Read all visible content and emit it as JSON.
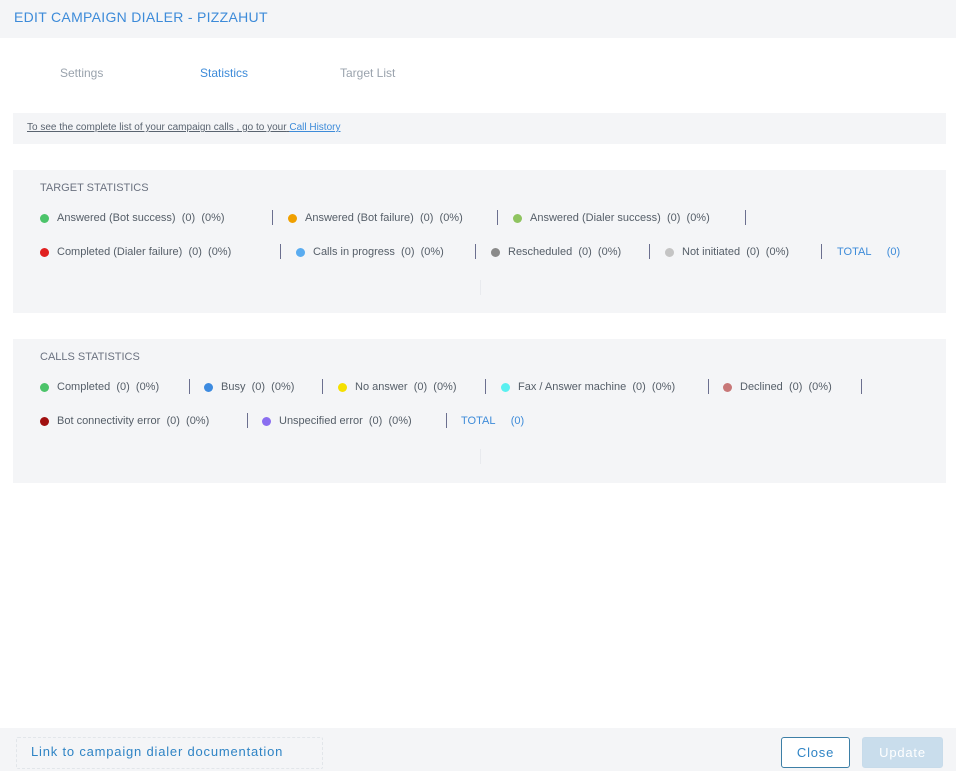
{
  "header": {
    "title": "EDIT CAMPAIGN DIALER - PIZZAHUT"
  },
  "tabs": [
    {
      "label": "Settings",
      "active": false
    },
    {
      "label": "Statistics",
      "active": true
    },
    {
      "label": "Target List",
      "active": false
    }
  ],
  "info": {
    "text": "To see the complete list of your campaign calls , go to your",
    "link": "Call History"
  },
  "target_statistics": {
    "title": "TARGET STATISTICS",
    "items": [
      {
        "label": "Answered (Bot success)",
        "count": "(0)",
        "percent": "(0%)",
        "color": "#4cc46a"
      },
      {
        "label": "Answered (Bot failure)",
        "count": "(0)",
        "percent": "(0%)",
        "color": "#f0a000"
      },
      {
        "label": "Answered (Dialer success)",
        "count": "(0)",
        "percent": "(0%)",
        "color": "#8fc460"
      },
      {
        "label": "Completed (Dialer failure)",
        "count": "(0)",
        "percent": "(0%)",
        "color": "#e02020"
      },
      {
        "label": "Calls in progress",
        "count": "(0)",
        "percent": "(0%)",
        "color": "#5aacf0"
      },
      {
        "label": "Rescheduled",
        "count": "(0)",
        "percent": "(0%)",
        "color": "#8a8a8a"
      },
      {
        "label": "Not initiated",
        "count": "(0)",
        "percent": "(0%)",
        "color": "#c4c4c4"
      }
    ],
    "total_label": "TOTAL",
    "total_value": "(0)"
  },
  "calls_statistics": {
    "title": "CALLS STATISTICS",
    "items": [
      {
        "label": "Completed",
        "count": "(0)",
        "percent": "(0%)",
        "color": "#4cc46a"
      },
      {
        "label": "Busy",
        "count": "(0)",
        "percent": "(0%)",
        "color": "#3d8be0"
      },
      {
        "label": "No answer",
        "count": "(0)",
        "percent": "(0%)",
        "color": "#f5e000"
      },
      {
        "label": "Fax / Answer machine",
        "count": "(0)",
        "percent": "(0%)",
        "color": "#5af0f0"
      },
      {
        "label": "Declined",
        "count": "(0)",
        "percent": "(0%)",
        "color": "#c87878"
      },
      {
        "label": "Bot connectivity error",
        "count": "(0)",
        "percent": "(0%)",
        "color": "#a01010"
      },
      {
        "label": "Unspecified error",
        "count": "(0)",
        "percent": "(0%)",
        "color": "#8a6ef0"
      }
    ],
    "total_label": "TOTAL",
    "total_value": "(0)"
  },
  "footer": {
    "doc_link": "Link to campaign dialer documentation",
    "close_label": "Close",
    "update_label": "Update"
  }
}
